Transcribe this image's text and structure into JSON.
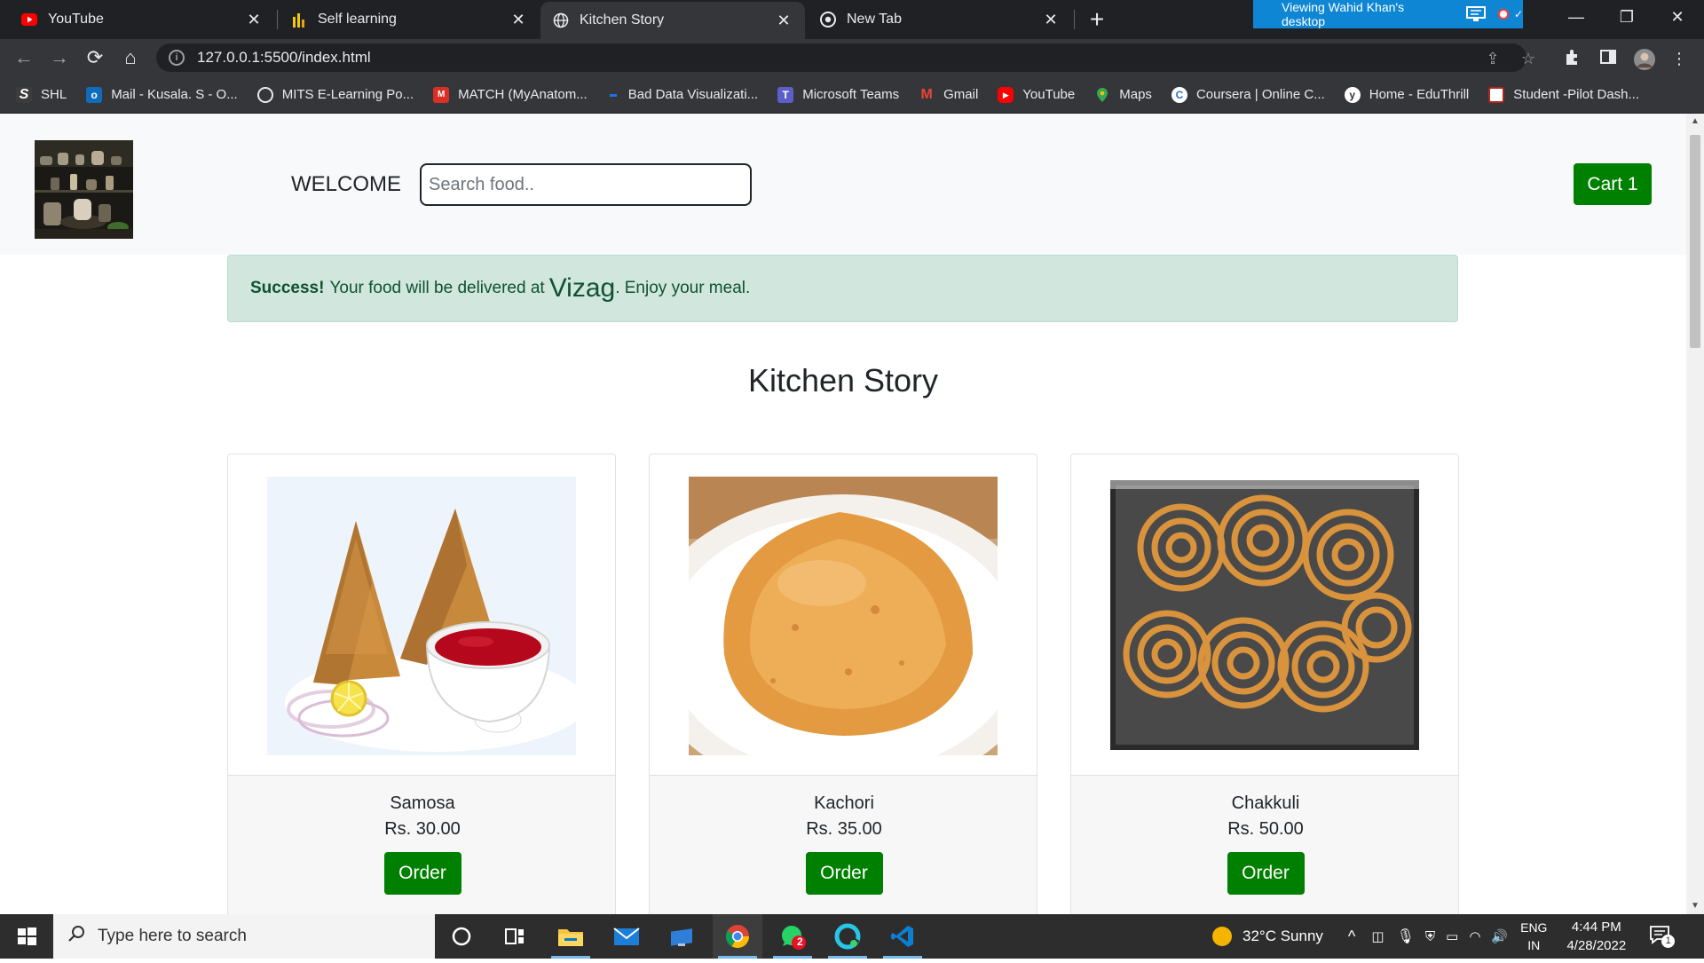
{
  "browser": {
    "tabs": [
      {
        "title": "YouTube",
        "icon": "youtube-icon"
      },
      {
        "title": "Self learning",
        "icon": "powerbi-icon"
      },
      {
        "title": "Kitchen Story",
        "icon": "globe-icon",
        "active": true
      },
      {
        "title": "New Tab",
        "icon": "chrome-icon"
      }
    ],
    "remote_banner": "Viewing Wahid Khan's desktop",
    "url": "127.0.0.1:5500/index.html",
    "bookmarks": [
      {
        "label": "SHL",
        "icon": "shl-icon",
        "color": "#3c3c3c"
      },
      {
        "label": "Mail - Kusala. S - O...",
        "icon": "outlook-icon",
        "color": "#0f6cbd"
      },
      {
        "label": "MITS E-Learning Po...",
        "icon": "globe-icon",
        "color": "#5f6368"
      },
      {
        "label": "MATCH (MyAnatom...",
        "icon": "match-icon",
        "color": "#d93025"
      },
      {
        "label": "Bad Data Visualizati...",
        "icon": "medium-icon",
        "color": "#1a73e8"
      },
      {
        "label": "Microsoft Teams",
        "icon": "teams-icon",
        "color": "#5b5fc7"
      },
      {
        "label": "Gmail",
        "icon": "gmail-icon",
        "color": "#ea4335"
      },
      {
        "label": "YouTube",
        "icon": "youtube-icon",
        "color": "#ff0000"
      },
      {
        "label": "Maps",
        "icon": "maps-icon",
        "color": "#34a853"
      },
      {
        "label": "Coursera | Online C...",
        "icon": "coursera-icon",
        "color": "#2a73cc"
      },
      {
        "label": "Home - EduThrill",
        "icon": "eduthrill-icon",
        "color": "#ffffff"
      },
      {
        "label": "Student -Pilot Dash...",
        "icon": "student-icon",
        "color": "#b3261e"
      }
    ]
  },
  "page": {
    "welcome": "WELCOME",
    "search_placeholder": "Search food..",
    "cart_label": "Cart 1",
    "alert": {
      "strong": "Success!",
      "text_before": "Your food will be delivered at",
      "city": "Vizag",
      "text_after": ". Enjoy your meal."
    },
    "heading": "Kitchen Story",
    "items": [
      {
        "name": "Samosa",
        "price": "Rs. 30.00",
        "button": "Order",
        "image": "samosa"
      },
      {
        "name": "Kachori",
        "price": "Rs. 35.00",
        "button": "Order",
        "image": "kachori"
      },
      {
        "name": "Chakkuli",
        "price": "Rs. 50.00",
        "button": "Order",
        "image": "chakkuli"
      }
    ]
  },
  "taskbar": {
    "search_placeholder": "Type here to search",
    "weather": "32°C  Sunny",
    "lang_top": "ENG",
    "lang_bottom": "IN",
    "time": "4:44 PM",
    "date": "4/28/2022",
    "whatsapp_badge": "2",
    "notification_count": "1"
  },
  "colors": {
    "accent_green": "#008000",
    "alert_bg": "#d1e7dd",
    "alert_text": "#0f5132",
    "chrome_dark": "#202124",
    "chrome_toolbar": "#35363a"
  }
}
